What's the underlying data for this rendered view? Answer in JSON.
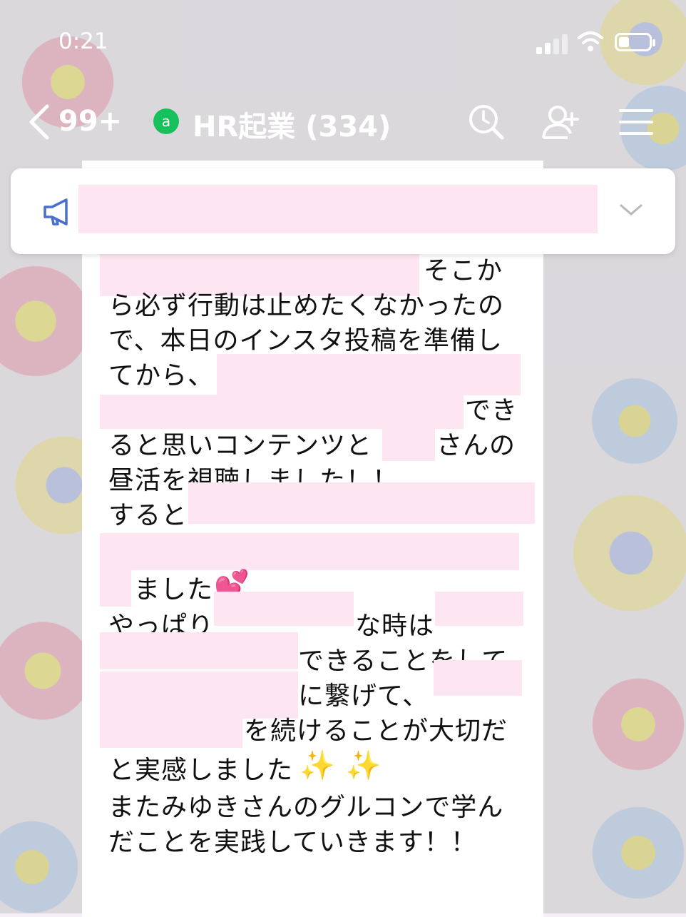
{
  "status_bar": {
    "time": "0:21",
    "battery_level": 0.35
  },
  "header": {
    "unread_count": "99+",
    "chat_title": "HR起業 (334)",
    "icons": [
      "back-icon",
      "official-account-icon",
      "search-icon",
      "add-friend-icon",
      "menu-icon"
    ]
  },
  "announcement": {
    "icon": "megaphone-icon",
    "text": ""
  },
  "message": {
    "text_1": "そこか",
    "text_2": "ら必ず行動は止めたくなかったの",
    "text_3": "で、本日のインスタ投稿を準備し",
    "text_4": "てから、",
    "text_5": "でき",
    "text_6a": "ると思いコンテンツと",
    "text_6b": "さんの",
    "text_7": "昼活を視聴しました！！",
    "text_8": "すると",
    "text_9": "ました",
    "text_10a": "やっぱり",
    "text_10b": "な時は",
    "text_11": "できることをして",
    "text_12": "に繋げて、",
    "text_13": "を続けることが大切だ",
    "text_14": "と実感しました",
    "text_15": "またみゆきさんのグルコンで学ん",
    "text_16": "だことを実践していきます！！",
    "emoji_heart": "💕",
    "emoji_sparkles": "✨ ✨"
  },
  "colors": {
    "redaction": "#fde6f1",
    "oa_badge": "#16c15b",
    "icon_blue": "#4a6fd1"
  }
}
